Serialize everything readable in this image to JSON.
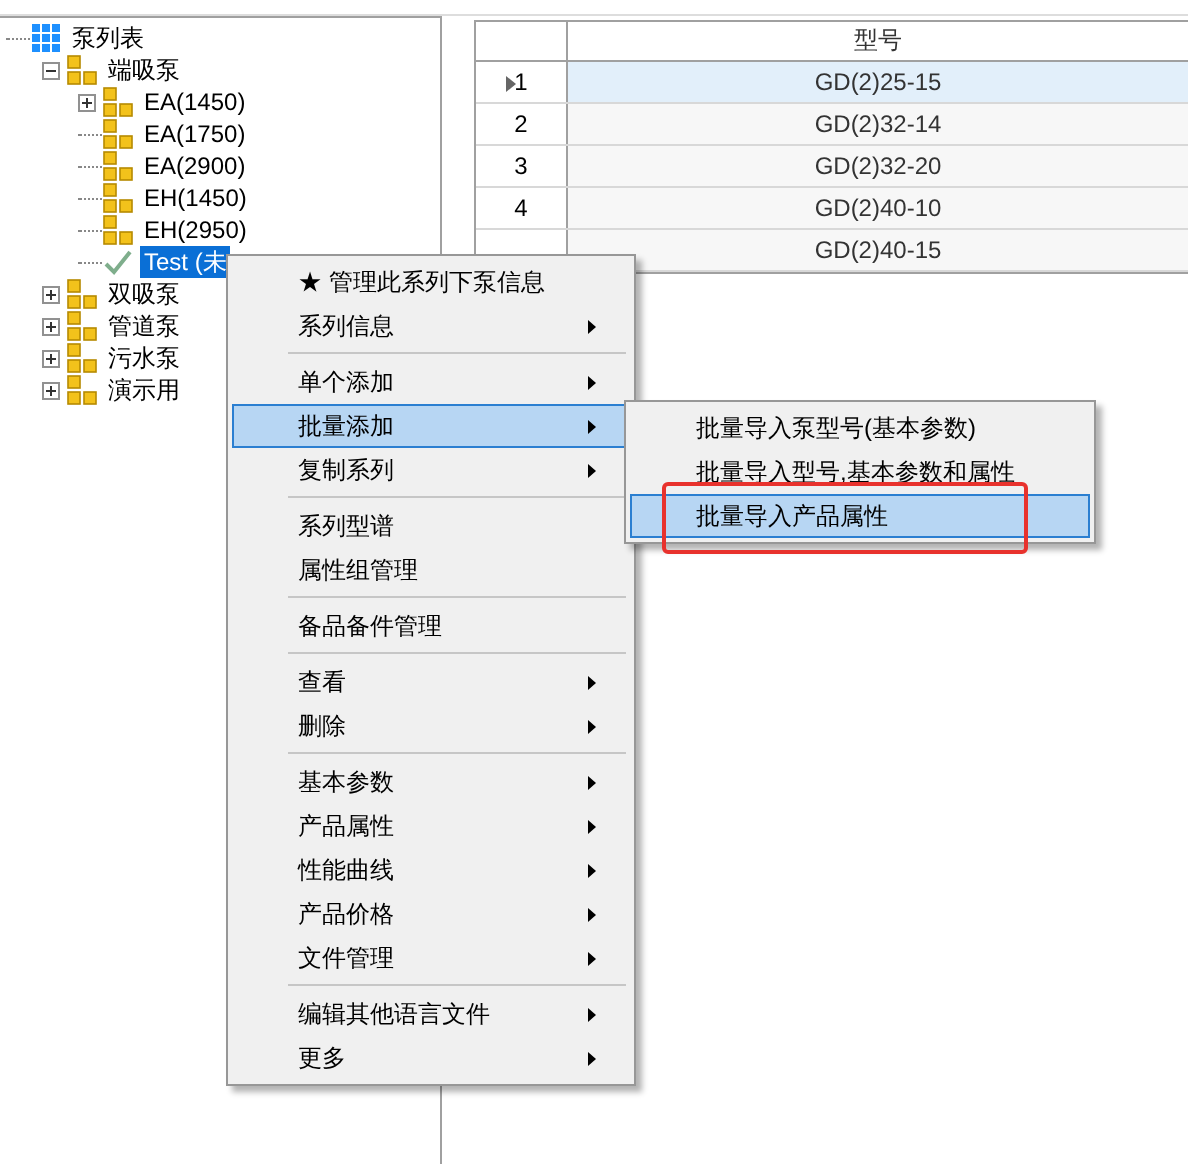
{
  "tree": {
    "label": "泵列表",
    "kind": "root",
    "selected": false,
    "children": [
      {
        "label": "端吸泵",
        "kind": "group",
        "expanded": true,
        "selected": false,
        "children": [
          {
            "label": "EA(1450)",
            "kind": "group",
            "expanded": false,
            "selected": false
          },
          {
            "label": "EA(1750)",
            "kind": "group",
            "selected": false
          },
          {
            "label": "EA(2900)",
            "kind": "group",
            "selected": false
          },
          {
            "label": "EH(1450)",
            "kind": "group",
            "selected": false
          },
          {
            "label": "EH(2950)",
            "kind": "group",
            "selected": false
          },
          {
            "label": "Test (未",
            "kind": "done",
            "selected": true
          }
        ]
      },
      {
        "label": "双吸泵",
        "kind": "group",
        "expanded": false,
        "selected": false
      },
      {
        "label": "管道泵",
        "kind": "group",
        "expanded": false,
        "selected": false
      },
      {
        "label": "污水泵",
        "kind": "group",
        "expanded": false,
        "selected": false
      },
      {
        "label": "演示用",
        "kind": "group",
        "expanded": false,
        "selected": false
      }
    ]
  },
  "grid": {
    "columns": [
      "型号"
    ],
    "rows": [
      {
        "number": "1",
        "model": "GD(2)25-15",
        "selected": true
      },
      {
        "number": "2",
        "model": "GD(2)32-14",
        "selected": false
      },
      {
        "number": "3",
        "model": "GD(2)32-20",
        "selected": false
      },
      {
        "number": "4",
        "model": "GD(2)40-10",
        "selected": false
      },
      {
        "model": "GD(2)40-15",
        "selected": false
      }
    ]
  },
  "context_menu": {
    "items": [
      {
        "kind": "item",
        "label": "★ 管理此系列下泵信息",
        "submenu": false,
        "selected": false
      },
      {
        "kind": "item",
        "label": "系列信息",
        "submenu": true,
        "selected": false
      },
      {
        "kind": "separator"
      },
      {
        "kind": "item",
        "label": "单个添加",
        "submenu": true,
        "selected": false
      },
      {
        "kind": "item",
        "label": "批量添加",
        "submenu": true,
        "selected": true
      },
      {
        "kind": "item",
        "label": "复制系列",
        "submenu": true,
        "selected": false
      },
      {
        "kind": "separator"
      },
      {
        "kind": "item",
        "label": "系列型谱",
        "submenu": false,
        "selected": false
      },
      {
        "kind": "item",
        "label": "属性组管理",
        "submenu": false,
        "selected": false
      },
      {
        "kind": "separator"
      },
      {
        "kind": "item",
        "label": "备品备件管理",
        "submenu": false,
        "selected": false
      },
      {
        "kind": "separator"
      },
      {
        "kind": "item",
        "label": "查看",
        "submenu": true,
        "selected": false
      },
      {
        "kind": "item",
        "label": "删除",
        "submenu": true,
        "selected": false
      },
      {
        "kind": "separator"
      },
      {
        "kind": "item",
        "label": "基本参数",
        "submenu": true,
        "selected": false
      },
      {
        "kind": "item",
        "label": "产品属性",
        "submenu": true,
        "selected": false
      },
      {
        "kind": "item",
        "label": "性能曲线",
        "submenu": true,
        "selected": false
      },
      {
        "kind": "item",
        "label": "产品价格",
        "submenu": true,
        "selected": false
      },
      {
        "kind": "item",
        "label": "文件管理",
        "submenu": true,
        "selected": false
      },
      {
        "kind": "separator"
      },
      {
        "kind": "item",
        "label": "编辑其他语言文件",
        "submenu": true,
        "selected": false
      },
      {
        "kind": "item",
        "label": "更多",
        "submenu": true,
        "selected": false
      }
    ]
  },
  "submenu": {
    "items": [
      {
        "label": "批量导入泵型号(基本参数)",
        "selected": false
      },
      {
        "label": "批量导入型号,基本参数和属性",
        "selected": false
      },
      {
        "label": "批量导入产品属性",
        "selected": true
      }
    ]
  },
  "annotations": [
    {
      "kind": "rectangle"
    }
  ]
}
